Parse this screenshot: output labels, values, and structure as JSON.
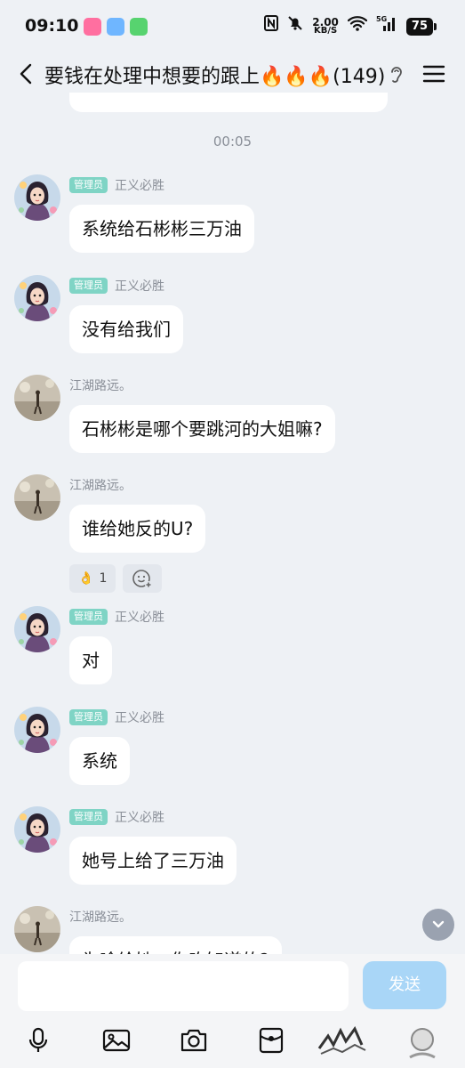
{
  "status_bar": {
    "time": "09:10",
    "net_speed_value": "2.00",
    "net_speed_unit": "KB/S",
    "battery": "75",
    "network": "5G"
  },
  "header": {
    "title": "要钱在处理中想要的跟上🔥🔥🔥(149)"
  },
  "timestamp": "00:05",
  "messages": [
    {
      "badge": "管理员",
      "sender": "正义必胜",
      "text": "系统给石彬彬三万油"
    },
    {
      "badge": "管理员",
      "sender": "正义必胜",
      "text": "没有给我们"
    },
    {
      "sender": "江湖路远。",
      "text": "石彬彬是哪个要跳河的大姐嘛?"
    },
    {
      "sender": "江湖路远。",
      "text": "谁给她反的U?"
    },
    {
      "badge": "管理员",
      "sender": "正义必胜",
      "text": "对"
    },
    {
      "badge": "管理员",
      "sender": "正义必胜",
      "text": "系统"
    },
    {
      "badge": "管理员",
      "sender": "正义必胜",
      "text": "她号上给了三万油"
    },
    {
      "sender": "江湖路远。",
      "text": "为啥给她，你咋知道的?"
    }
  ],
  "reaction": {
    "emoji": "👌",
    "count": "1"
  },
  "composer": {
    "send_label": "发送",
    "placeholder": ""
  },
  "toolbar_icons": [
    "microphone-icon",
    "image-icon",
    "camera-icon",
    "red-packet-icon",
    "sticker",
    "sticker"
  ],
  "colors": {
    "background": "#eef1f5",
    "admin_badge": "#7fd4c5",
    "send_button": "#a9d6f7"
  }
}
